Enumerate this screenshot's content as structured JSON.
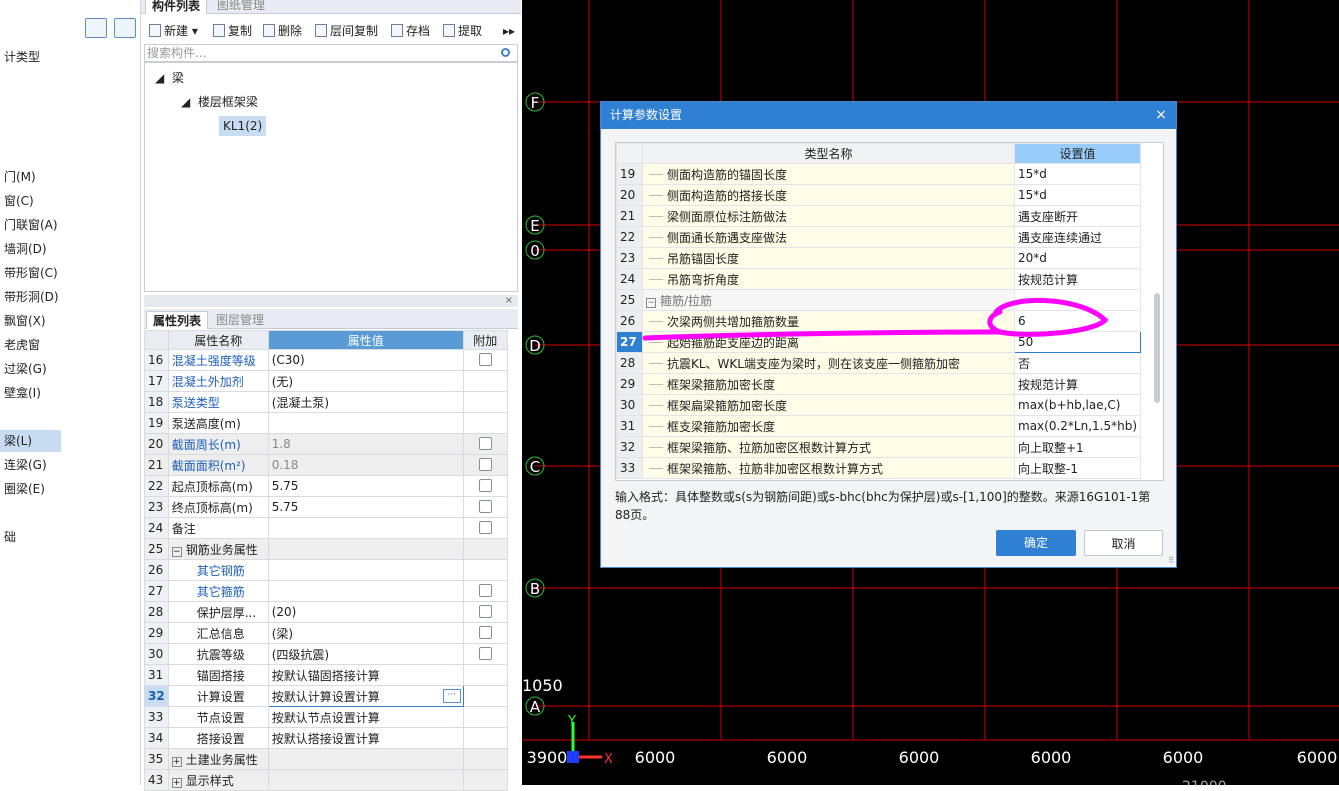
{
  "leftnav": {
    "type_label": "计类型",
    "items": [
      "门(M)",
      "窗(C)",
      "门联窗(A)",
      "墙洞(D)",
      "带形窗(C)",
      "带形洞(D)",
      "飘窗(X)",
      "老虎窗",
      "过梁(G)",
      "壁龛(I)",
      "梁(L)",
      "连梁(G)",
      "圈梁(E)"
    ],
    "selected": "梁(L)",
    "bottom_label": "础"
  },
  "complist": {
    "tab_active": "构件列表",
    "tab_inactive": "图纸管理",
    "toolbar": {
      "new": "新建",
      "copy": "复制",
      "delete": "删除",
      "floor_copy": "层间复制",
      "archive": "存档",
      "extract": "提取"
    },
    "search_placeholder": "搜索构件...",
    "tree": {
      "root": "梁",
      "child": "楼层框架梁",
      "leaf": "KL1(2)"
    }
  },
  "proppanel": {
    "close": "×",
    "tab_active": "属性列表",
    "tab_inactive": "图层管理",
    "headers": {
      "name": "属性名称",
      "value": "属性值",
      "extra": "附加"
    },
    "rows": [
      {
        "n": "16",
        "name": "混凝土强度等级",
        "value": "(C30)",
        "cb": true,
        "blue": true
      },
      {
        "n": "17",
        "name": "混凝土外加剂",
        "value": "(无)",
        "cb": false,
        "blue": true
      },
      {
        "n": "18",
        "name": "泵送类型",
        "value": "(混凝土泵)",
        "cb": false,
        "blue": true
      },
      {
        "n": "19",
        "name": "泵送高度(m)",
        "value": "",
        "cb": false,
        "blue": false
      },
      {
        "n": "20",
        "name": "截面周长(m)",
        "value": "1.8",
        "cb": true,
        "blue": true,
        "gray": true
      },
      {
        "n": "21",
        "name": "截面面积(m²)",
        "value": "0.18",
        "cb": true,
        "blue": true,
        "gray": true
      },
      {
        "n": "22",
        "name": "起点顶标高(m)",
        "value": "5.75",
        "cb": true,
        "blue": false
      },
      {
        "n": "23",
        "name": "终点顶标高(m)",
        "value": "5.75",
        "cb": true,
        "blue": false
      },
      {
        "n": "24",
        "name": "备注",
        "value": "",
        "cb": true,
        "blue": false
      },
      {
        "n": "25",
        "name": "钢筋业务属性",
        "value": "",
        "cb": false,
        "blue": false,
        "group": "−"
      },
      {
        "n": "26",
        "name": "其它钢筋",
        "value": "",
        "cb": false,
        "blue": true,
        "indent": true
      },
      {
        "n": "27",
        "name": "其它箍筋",
        "value": "",
        "cb": true,
        "blue": true,
        "indent": true
      },
      {
        "n": "28",
        "name": "保护层厚...",
        "value": "(20)",
        "cb": true,
        "blue": false,
        "indent": true
      },
      {
        "n": "29",
        "name": "汇总信息",
        "value": "(梁)",
        "cb": true,
        "blue": false,
        "indent": true
      },
      {
        "n": "30",
        "name": "抗震等级",
        "value": "(四级抗震)",
        "cb": true,
        "blue": false,
        "indent": true
      },
      {
        "n": "31",
        "name": "锚固搭接",
        "value": "按默认锚固搭接计算",
        "cb": false,
        "blue": false,
        "indent": true
      },
      {
        "n": "32",
        "name": "计算设置",
        "value": "按默认计算设置计算",
        "cb": false,
        "blue": false,
        "indent": true,
        "hilite": true
      },
      {
        "n": "33",
        "name": "节点设置",
        "value": "按默认节点设置计算",
        "cb": false,
        "blue": false,
        "indent": true
      },
      {
        "n": "34",
        "name": "搭接设置",
        "value": "按默认搭接设置计算",
        "cb": false,
        "blue": false,
        "indent": true
      },
      {
        "n": "35",
        "name": "土建业务属性",
        "value": "",
        "cb": false,
        "blue": false,
        "group": "+"
      },
      {
        "n": "43",
        "name": "显示样式",
        "value": "",
        "cb": false,
        "blue": false,
        "group": "+"
      }
    ]
  },
  "canvas": {
    "axis_labels": [
      "F",
      "E",
      "0",
      "D",
      "C",
      "B",
      "A"
    ],
    "dims": [
      "3900",
      "6000",
      "6000",
      "6000",
      "6000",
      "6000",
      "6000"
    ],
    "left_dim": "1050",
    "bottom_partial": "21000",
    "axis_y": "Y",
    "axis_x": "X",
    "colors": {
      "grid": "#d40000",
      "axis": "#2bbf2b",
      "text": "#ffffff"
    }
  },
  "dialog": {
    "title": "计算参数设置",
    "close": "×",
    "headers": {
      "name": "类型名称",
      "value": "设置值"
    },
    "rows": [
      {
        "n": "19",
        "name": "侧面构造筋的锚固长度",
        "value": "15*d"
      },
      {
        "n": "20",
        "name": "侧面构造筋的搭接长度",
        "value": "15*d"
      },
      {
        "n": "21",
        "name": "梁侧面原位标注筋做法",
        "value": "遇支座断开"
      },
      {
        "n": "22",
        "name": "侧面通长筋遇支座做法",
        "value": "遇支座连续通过"
      },
      {
        "n": "23",
        "name": "吊筋锚固长度",
        "value": "20*d"
      },
      {
        "n": "24",
        "name": "吊筋弯折角度",
        "value": "按规范计算"
      },
      {
        "n": "25",
        "name": "箍筋/拉筋",
        "value": "",
        "group": true
      },
      {
        "n": "26",
        "name": "次梁两侧共增加箍筋数量",
        "value": "6"
      },
      {
        "n": "27",
        "name": "起始箍筋距支座边的距离",
        "value": "50",
        "active": true
      },
      {
        "n": "28",
        "name": "抗震KL、WKL端支座为梁时，则在该支座一侧箍筋加密",
        "value": "否"
      },
      {
        "n": "29",
        "name": "框架梁箍筋加密长度",
        "value": "按规范计算"
      },
      {
        "n": "30",
        "name": "框架扁梁箍筋加密长度",
        "value": "max(b+hb,lae,C)"
      },
      {
        "n": "31",
        "name": "框支梁箍筋加密长度",
        "value": "max(0.2*Ln,1.5*hb)"
      },
      {
        "n": "32",
        "name": "框架梁箍筋、拉筋加密区根数计算方式",
        "value": "向上取整+1"
      },
      {
        "n": "33",
        "name": "框架梁箍筋、拉筋非加密区根数计算方式",
        "value": "向上取整-1"
      }
    ],
    "hint": "输入格式：具体整数或s(s为钢筋间距)或s-bhc(bhc为保护层)或s-[1,100]的整数。来源16G101-1第88页。",
    "ok": "确定",
    "cancel": "取消"
  }
}
